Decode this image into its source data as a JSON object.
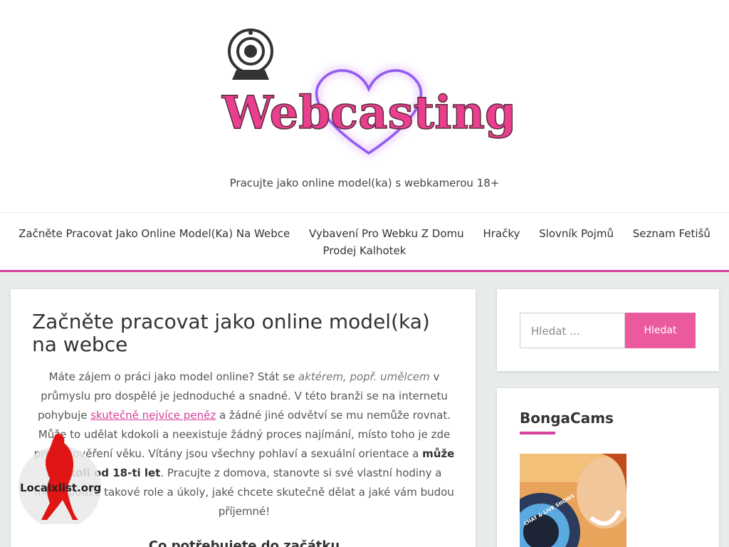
{
  "header": {
    "logo_text": "Webcasting",
    "tagline": "Pracujte jako online model(ka) s webkamerou 18+"
  },
  "nav": {
    "items": [
      {
        "label": "Začněte Pracovat Jako Online Model(Ka) Na Webce"
      },
      {
        "label": "Vybavení Pro Webku Z Domu"
      },
      {
        "label": "Hračky"
      },
      {
        "label": "Slovník Pojmů"
      },
      {
        "label": "Seznam Fetišů"
      },
      {
        "label": "Prodej Kalhotek"
      }
    ]
  },
  "post": {
    "title": "Začněte pracovat jako online model(ka) na webce",
    "p1_a": "Máte zájem o práci jako model online? Stát se ",
    "p1_em": "aktérem, popř. umělcem",
    "p1_b": " v průmyslu pro dospělé je jednoduché a snadné. V této branži se na internetu pohybuje ",
    "p1_link": "skutečně nejvíce peněz",
    "p1_c": " a žádné jiné odvětví se mu nemůže rovnat. Může to udělat kdokoli a neexistuje žádný proces najímání, místo toho je zde proces ověření věku. Vítány jsou všechny pohlaví a sexuální orientace a ",
    "p1_bold": "může kdokoli od 18-ti let",
    "p1_d": ". Pracujte z domova, stanovte si své vlastní hodiny a mějte pouze takové role a úkoly, jaké chcete skutečně dělat a jaké vám budou příjemné!",
    "subheading": "Co potřebujete do začátku"
  },
  "search": {
    "placeholder": "Hledat …",
    "button": "Hledat"
  },
  "bonga": {
    "title": "BongaCams",
    "badge": "CHAT & LIVE SHOWS"
  },
  "watermark": {
    "text": "Localxlist.org"
  },
  "colors": {
    "accent": "#d63f9c",
    "button": "#ea5a9c",
    "background": "#e8ece9"
  }
}
